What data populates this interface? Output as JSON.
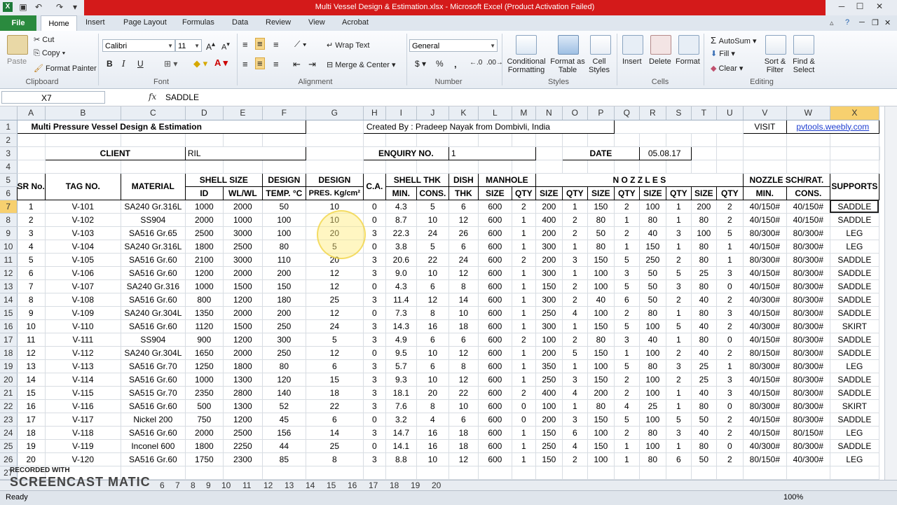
{
  "window": {
    "title": "Multi Vessel Design & Estimation.xlsx  -  Microsoft Excel (Product Activation Failed)",
    "min": "─",
    "max": "☐",
    "close": "✕"
  },
  "ribbon_tabs": [
    "File",
    "Home",
    "Insert",
    "Page Layout",
    "Formulas",
    "Data",
    "Review",
    "View",
    "Acrobat"
  ],
  "ribbon": {
    "clipboard": {
      "paste": "Paste",
      "cut": "Cut",
      "copy": "Copy",
      "format_painter": "Format Painter",
      "label": "Clipboard"
    },
    "font": {
      "name": "Calibri",
      "size": "11",
      "label": "Font",
      "bold": "B",
      "italic": "I",
      "underline": "U"
    },
    "alignment": {
      "wrap": "Wrap Text",
      "merge": "Merge & Center",
      "label": "Alignment"
    },
    "number": {
      "format": "General",
      "currency": "$",
      "percent": "%",
      "comma": ",",
      "label": "Number"
    },
    "styles": {
      "conditional": "Conditional Formatting",
      "format_table": "Format as Table",
      "cell_styles": "Cell Styles",
      "label": "Styles"
    },
    "cells": {
      "insert": "Insert",
      "delete": "Delete",
      "format": "Format",
      "label": "Cells"
    },
    "editing": {
      "autosum": "AutoSum",
      "fill": "Fill",
      "clear": "Clear",
      "sort": "Sort & Filter",
      "find": "Find & Select",
      "label": "Editing"
    }
  },
  "formula_bar": {
    "name_box": "X7",
    "fx": "fx",
    "content": "SADDLE"
  },
  "columns": [
    "A",
    "B",
    "C",
    "D",
    "E",
    "F",
    "G",
    "H",
    "I",
    "J",
    "K",
    "L",
    "M",
    "N",
    "O",
    "P",
    "Q",
    "R",
    "S",
    "T",
    "U",
    "V",
    "W",
    "X"
  ],
  "sheet": {
    "title": "Multi Pressure Vessel  Design & Estimation",
    "created_by": "Created By : Pradeep Nayak from Dombivli, India",
    "visit": "VISIT",
    "link": "pvtools.weebly.com",
    "client_label": "CLIENT",
    "client": "RIL",
    "enquiry_label": "ENQUIRY NO.",
    "enquiry": "1",
    "date_label": "DATE",
    "date": "05.08.17",
    "headers": {
      "sr": "SR No.",
      "tag": "TAG NO.",
      "material": "MATERIAL",
      "shell_size": "SHELL SIZE",
      "id": "ID",
      "wl": "WL/WL",
      "design_temp1": "DESIGN",
      "design_temp2": "TEMP. °C",
      "design_pres1": "DESIGN",
      "design_pres2": "PRES. Kg/cm²",
      "ca": "C.A.",
      "shell_thk": "SHELL THK",
      "min": "MIN.",
      "cons": "CONS.",
      "dish1": "DISH",
      "dish2": "THK",
      "manhole": "MANHOLE",
      "size": "SIZE",
      "qty": "QTY",
      "nozzles": "N O Z Z L E S",
      "nozzle_sch": "NOZZLE  SCH/RAT.",
      "supports": "SUPPORTS"
    },
    "rows": [
      [
        "1",
        "V-101",
        "SA240 Gr.316L",
        "1000",
        "2000",
        "50",
        "10",
        "0",
        "4.3",
        "5",
        "6",
        "600",
        "2",
        "200",
        "1",
        "150",
        "2",
        "100",
        "1",
        "200",
        "2",
        "40/150#",
        "40/150#",
        "SADDLE"
      ],
      [
        "2",
        "V-102",
        "SS904",
        "2000",
        "1000",
        "100",
        "10",
        "0",
        "8.7",
        "10",
        "12",
        "600",
        "1",
        "400",
        "2",
        "80",
        "1",
        "80",
        "1",
        "80",
        "2",
        "40/150#",
        "40/150#",
        "SADDLE"
      ],
      [
        "3",
        "V-103",
        "SA516 Gr.65",
        "2500",
        "3000",
        "100",
        "20",
        "3",
        "22.3",
        "24",
        "26",
        "600",
        "1",
        "200",
        "2",
        "50",
        "2",
        "40",
        "3",
        "100",
        "5",
        "80/300#",
        "80/300#",
        "LEG"
      ],
      [
        "4",
        "V-104",
        "SA240 Gr.316L",
        "1800",
        "2500",
        "80",
        "5",
        "0",
        "3.8",
        "5",
        "6",
        "600",
        "1",
        "300",
        "1",
        "80",
        "1",
        "150",
        "1",
        "80",
        "1",
        "40/150#",
        "80/300#",
        "LEG"
      ],
      [
        "5",
        "V-105",
        "SA516 Gr.60",
        "2100",
        "3000",
        "110",
        "20",
        "3",
        "20.6",
        "22",
        "24",
        "600",
        "2",
        "200",
        "3",
        "150",
        "5",
        "250",
        "2",
        "80",
        "1",
        "80/300#",
        "80/300#",
        "SADDLE"
      ],
      [
        "6",
        "V-106",
        "SA516 Gr.60",
        "1200",
        "2000",
        "200",
        "12",
        "3",
        "9.0",
        "10",
        "12",
        "600",
        "1",
        "300",
        "1",
        "100",
        "3",
        "50",
        "5",
        "25",
        "3",
        "40/150#",
        "80/300#",
        "SADDLE"
      ],
      [
        "7",
        "V-107",
        "SA240 Gr.316",
        "1000",
        "1500",
        "150",
        "12",
        "0",
        "4.3",
        "6",
        "8",
        "600",
        "1",
        "150",
        "2",
        "100",
        "5",
        "50",
        "3",
        "80",
        "0",
        "40/150#",
        "80/300#",
        "SADDLE"
      ],
      [
        "8",
        "V-108",
        "SA516 Gr.60",
        "800",
        "1200",
        "180",
        "25",
        "3",
        "11.4",
        "12",
        "14",
        "600",
        "1",
        "300",
        "2",
        "40",
        "6",
        "50",
        "2",
        "40",
        "2",
        "40/300#",
        "80/300#",
        "SADDLE"
      ],
      [
        "9",
        "V-109",
        "SA240 Gr.304L",
        "1350",
        "2000",
        "200",
        "12",
        "0",
        "7.3",
        "8",
        "10",
        "600",
        "1",
        "250",
        "4",
        "100",
        "2",
        "80",
        "1",
        "80",
        "3",
        "40/150#",
        "80/300#",
        "SADDLE"
      ],
      [
        "10",
        "V-110",
        "SA516 Gr.60",
        "1120",
        "1500",
        "250",
        "24",
        "3",
        "14.3",
        "16",
        "18",
        "600",
        "1",
        "300",
        "1",
        "150",
        "5",
        "100",
        "5",
        "40",
        "2",
        "40/300#",
        "80/300#",
        "SKIRT"
      ],
      [
        "11",
        "V-111",
        "SS904",
        "900",
        "1200",
        "300",
        "5",
        "3",
        "4.9",
        "6",
        "6",
        "600",
        "2",
        "100",
        "2",
        "80",
        "3",
        "40",
        "1",
        "80",
        "0",
        "40/150#",
        "80/300#",
        "SADDLE"
      ],
      [
        "12",
        "V-112",
        "SA240 Gr.304L",
        "1650",
        "2000",
        "250",
        "12",
        "0",
        "9.5",
        "10",
        "12",
        "600",
        "1",
        "200",
        "5",
        "150",
        "1",
        "100",
        "2",
        "40",
        "2",
        "80/150#",
        "80/300#",
        "SADDLE"
      ],
      [
        "13",
        "V-113",
        "SA516 Gr.70",
        "1250",
        "1800",
        "80",
        "6",
        "3",
        "5.7",
        "6",
        "8",
        "600",
        "1",
        "350",
        "1",
        "100",
        "5",
        "80",
        "3",
        "25",
        "1",
        "80/300#",
        "80/300#",
        "LEG"
      ],
      [
        "14",
        "V-114",
        "SA516 Gr.60",
        "1000",
        "1300",
        "120",
        "15",
        "3",
        "9.3",
        "10",
        "12",
        "600",
        "1",
        "250",
        "3",
        "150",
        "2",
        "100",
        "2",
        "25",
        "3",
        "40/150#",
        "80/300#",
        "SADDLE"
      ],
      [
        "15",
        "V-115",
        "SA515 Gr.70",
        "2350",
        "2800",
        "140",
        "18",
        "3",
        "18.1",
        "20",
        "22",
        "600",
        "2",
        "400",
        "4",
        "200",
        "2",
        "100",
        "1",
        "40",
        "3",
        "40/150#",
        "80/300#",
        "SADDLE"
      ],
      [
        "16",
        "V-116",
        "SA516 Gr.60",
        "500",
        "1300",
        "52",
        "22",
        "3",
        "7.6",
        "8",
        "10",
        "600",
        "0",
        "100",
        "1",
        "80",
        "4",
        "25",
        "1",
        "80",
        "0",
        "80/300#",
        "80/300#",
        "SKIRT"
      ],
      [
        "17",
        "V-117",
        "Nickel 200",
        "750",
        "1200",
        "45",
        "6",
        "0",
        "3.2",
        "4",
        "6",
        "600",
        "0",
        "200",
        "3",
        "150",
        "5",
        "100",
        "5",
        "50",
        "2",
        "40/150#",
        "80/300#",
        "SADDLE"
      ],
      [
        "18",
        "V-118",
        "SA516 Gr.60",
        "2000",
        "2500",
        "156",
        "14",
        "3",
        "14.7",
        "16",
        "18",
        "600",
        "1",
        "150",
        "6",
        "100",
        "2",
        "80",
        "3",
        "40",
        "2",
        "40/150#",
        "80/150#",
        "LEG"
      ],
      [
        "19",
        "V-119",
        "Inconel 600",
        "1800",
        "2250",
        "44",
        "25",
        "0",
        "14.1",
        "16",
        "18",
        "600",
        "1",
        "250",
        "4",
        "150",
        "1",
        "100",
        "1",
        "80",
        "0",
        "40/300#",
        "80/300#",
        "SADDLE"
      ],
      [
        "20",
        "V-120",
        "SA516 Gr.60",
        "1750",
        "2300",
        "85",
        "8",
        "3",
        "8.8",
        "10",
        "12",
        "600",
        "1",
        "150",
        "2",
        "100",
        "1",
        "80",
        "6",
        "50",
        "2",
        "80/150#",
        "40/300#",
        "LEG"
      ]
    ]
  },
  "sheet_tabs": [
    "6",
    "7",
    "8",
    "9",
    "10",
    "11",
    "12",
    "13",
    "14",
    "15",
    "16",
    "17",
    "18",
    "19",
    "20"
  ],
  "status": {
    "ready": "Ready",
    "zoom": "100%"
  },
  "watermark": {
    "line1": "RECORDED WITH",
    "line2": "SCREENCAST  MATIC"
  }
}
